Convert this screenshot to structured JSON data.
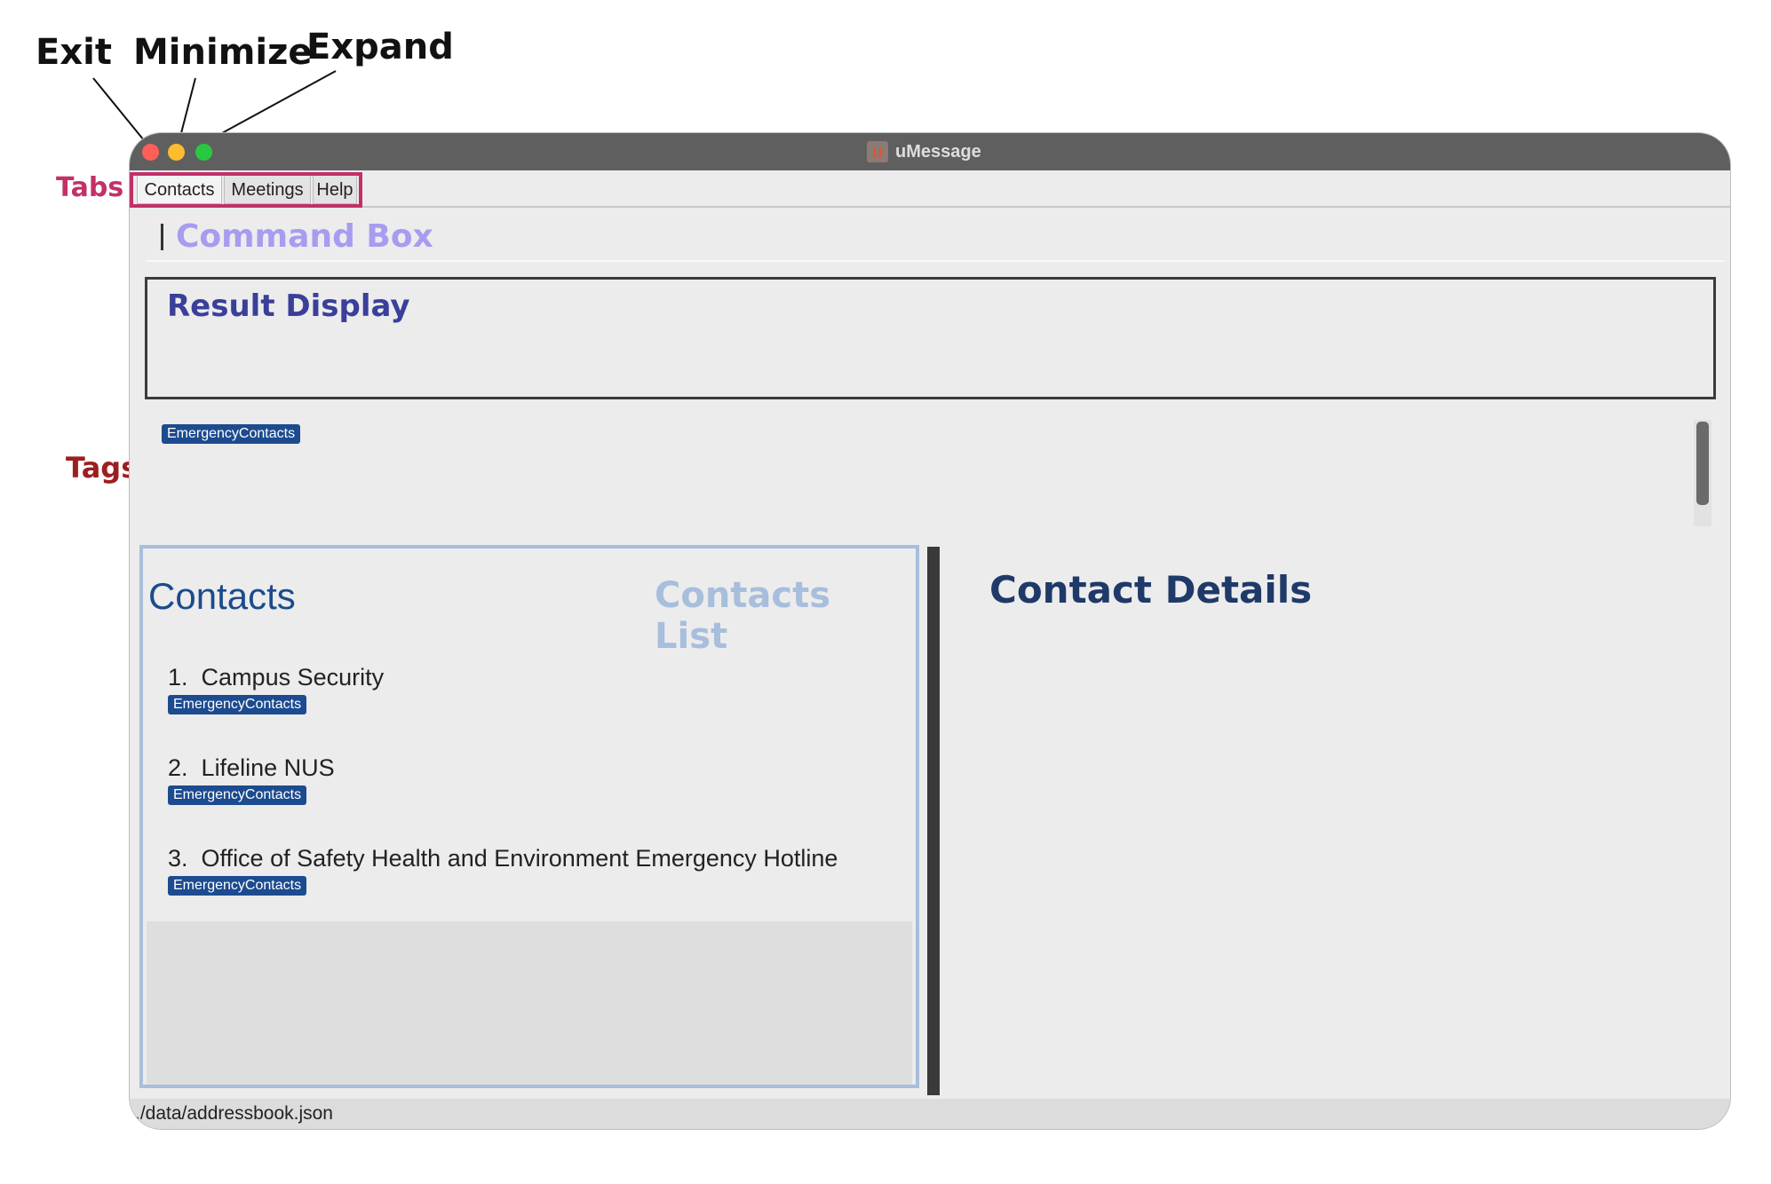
{
  "annotations": {
    "exit": "Exit",
    "minimize": "Minimize",
    "expand": "Expand",
    "tabs": "Tabs",
    "tags": "Tags",
    "command_box": "Command Box",
    "result_display": "Result Display",
    "contacts_list": "Contacts List",
    "contact_details": "Contact Details"
  },
  "window": {
    "title": "uMessage",
    "logo_letter": "u",
    "buttons": {
      "close_color": "#ff5f57",
      "minimize_color": "#febc2e",
      "expand_color": "#28c840"
    }
  },
  "tabs": [
    {
      "label": "Contacts",
      "active": true
    },
    {
      "label": "Meetings",
      "active": false
    },
    {
      "label": "Help",
      "active": false
    }
  ],
  "command_box": {
    "value": ""
  },
  "result_display": {
    "text": ""
  },
  "tags": [
    "EmergencyContacts"
  ],
  "contacts": {
    "header": "Contacts",
    "items": [
      {
        "index": "1.",
        "name": "Campus Security",
        "tag": "EmergencyContacts"
      },
      {
        "index": "2.",
        "name": "Lifeline NUS",
        "tag": "EmergencyContacts"
      },
      {
        "index": "3.",
        "name": "Office of Safety Health and Environment Emergency Hotline",
        "tag": "EmergencyContacts"
      }
    ]
  },
  "status_bar": {
    "path": "./data/addressbook.json"
  },
  "colors": {
    "tag_bg": "#1d4b8f",
    "accent_pink": "#c33069",
    "contacts_header": "#1b4b8c"
  }
}
